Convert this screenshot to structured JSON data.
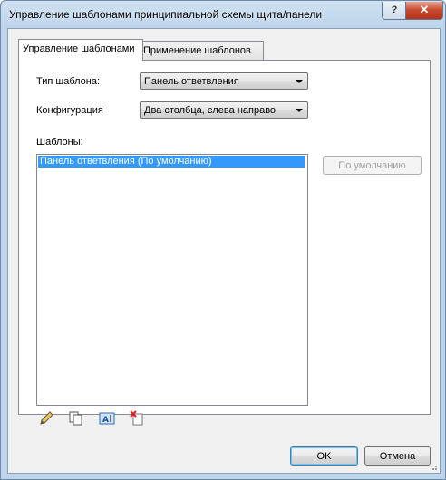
{
  "window": {
    "title": "Управление шаблонами принципиальной схемы щита/панели",
    "help_symbol": "?",
    "close_symbol": "✕"
  },
  "tabs": [
    {
      "label": "Управление шаблонами",
      "active": true
    },
    {
      "label": "Применение шаблонов",
      "active": false
    }
  ],
  "template_type": {
    "label": "Тип шаблона:",
    "value": "Панель ответвления"
  },
  "configuration": {
    "label": "Конфигурация",
    "value": "Два столбца, слева направо"
  },
  "templates": {
    "label": "Шаблоны:",
    "items": [
      "Панель ответвления (По умолчанию)"
    ],
    "selected_index": 0
  },
  "buttons": {
    "default": "По умолчанию",
    "ok": "OK",
    "cancel": "Отмена"
  },
  "toolbar_icons": [
    "edit-icon",
    "duplicate-icon",
    "rename-icon",
    "delete-icon"
  ]
}
